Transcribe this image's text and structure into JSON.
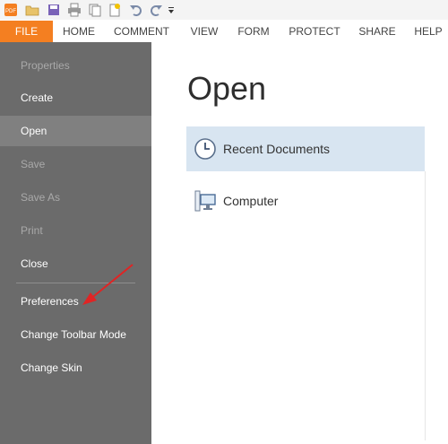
{
  "colors": {
    "accent": "#f47f21",
    "sidebar_bg": "#6b6b6b",
    "sidebar_selected": "#808080",
    "place_selected": "#d8e5f1",
    "annotation_arrow": "#e02424"
  },
  "quick_access": [
    {
      "icon": "pdf-app-icon"
    },
    {
      "icon": "open-folder-icon"
    },
    {
      "icon": "save-icon"
    },
    {
      "icon": "print-icon"
    },
    {
      "icon": "copy-icon"
    },
    {
      "icon": "new-document-icon"
    },
    {
      "icon": "undo-icon"
    },
    {
      "icon": "redo-icon"
    },
    {
      "icon": "customize-dropdown-icon"
    }
  ],
  "ribbon_tabs": [
    "FILE",
    "HOME",
    "COMMENT",
    "VIEW",
    "FORM",
    "PROTECT",
    "SHARE",
    "HELP"
  ],
  "sidebar": {
    "items": [
      {
        "label": "Properties",
        "state": "disabled"
      },
      {
        "label": "Create",
        "state": "enabled"
      },
      {
        "label": "Open",
        "state": "selected"
      },
      {
        "label": "Save",
        "state": "disabled"
      },
      {
        "label": "Save As",
        "state": "disabled"
      },
      {
        "label": "Print",
        "state": "disabled"
      },
      {
        "label": "Close",
        "state": "enabled"
      },
      {
        "label": "Preferences",
        "state": "enabled"
      },
      {
        "label": "Change Toolbar Mode",
        "state": "enabled"
      },
      {
        "label": "Change Skin",
        "state": "enabled"
      }
    ]
  },
  "main": {
    "title": "Open",
    "places": [
      {
        "label": "Recent Documents",
        "icon": "clock-icon",
        "selected": true
      },
      {
        "label": "Computer",
        "icon": "computer-icon",
        "selected": false
      }
    ]
  }
}
